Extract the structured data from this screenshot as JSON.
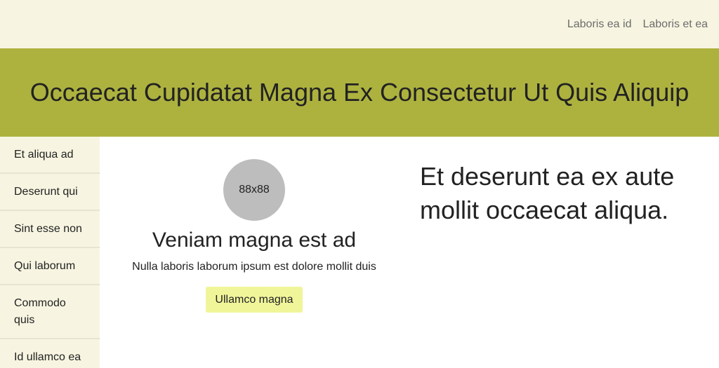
{
  "topnav": {
    "links": [
      "Laboris ea id",
      "Laboris et ea"
    ]
  },
  "banner": {
    "title": "Occaecat Cupidatat Magna Ex Consectetur Ut Quis Aliquip"
  },
  "sidebar": {
    "items": [
      {
        "label": "Et aliqua ad"
      },
      {
        "label": "Deserunt qui"
      },
      {
        "label": "Sint esse non"
      },
      {
        "label": "Qui laborum"
      },
      {
        "label": "Commodo quis"
      },
      {
        "label": "Id ullamco ea"
      }
    ]
  },
  "card": {
    "avatar_text": "88x88",
    "title": "Veniam magna est ad",
    "text": "Nulla laboris laborum ipsum est dolore mollit duis",
    "button_label": "Ullamco magna"
  },
  "headline": {
    "text": "Et deserunt ea ex aute mollit occaecat aliqua."
  },
  "colors": {
    "topbar_bg": "#f7f5e1",
    "banner_bg": "#adb23f",
    "sidebar_bg": "#f7f5e1",
    "button_bg": "#f0f59a",
    "avatar_bg": "#bdbdbd"
  }
}
